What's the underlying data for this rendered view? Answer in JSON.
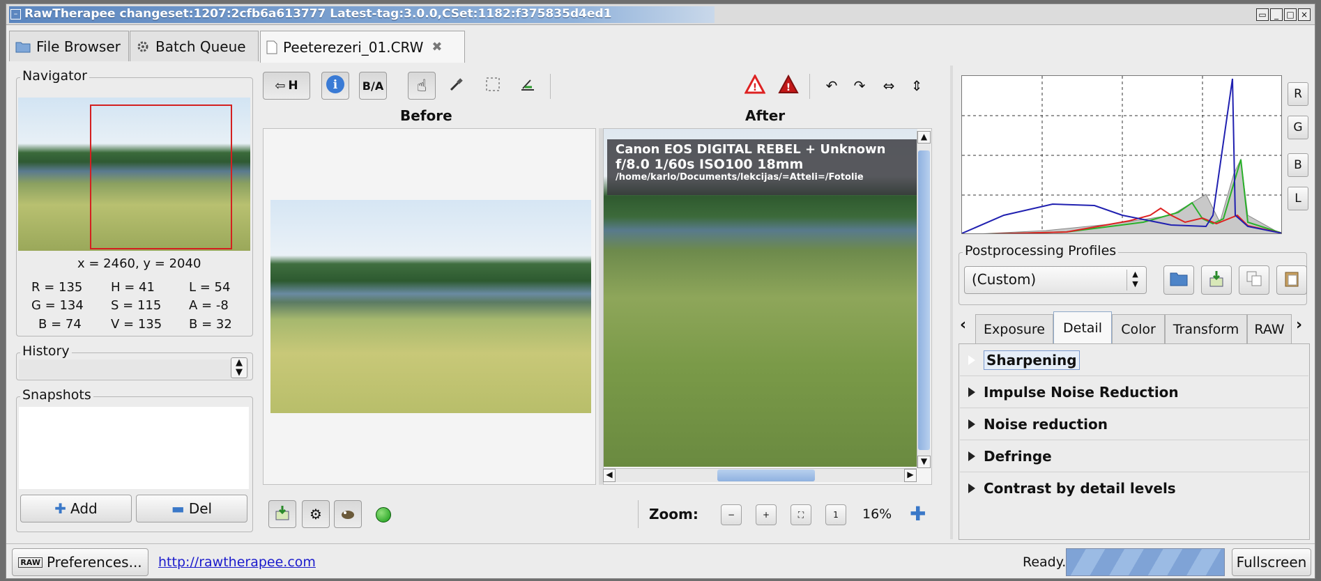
{
  "window": {
    "title": "RawTherapee changeset:1207:2cfb6a613777 Latest-tag:3.0.0,CSet:1182:f375835d4ed1"
  },
  "tabs": [
    {
      "label": "File Browser",
      "icon": "folder-icon"
    },
    {
      "label": "Batch Queue",
      "icon": "gear-icon"
    },
    {
      "label": "Peeterezeri_01.CRW",
      "icon": "document-icon"
    }
  ],
  "navigator": {
    "label": "Navigator",
    "coords": "x = 2460, y = 2040",
    "values": {
      "R": "R = 135",
      "G": "G = 134",
      "B": "B = 74",
      "H": "H = 41",
      "S": "S = 115",
      "V": "V = 135",
      "L": "L = 54",
      "A": "A = -8",
      "B2": "B = 32"
    }
  },
  "history": {
    "label": "History"
  },
  "snapshots": {
    "label": "Snapshots",
    "add": "Add",
    "del": "Del"
  },
  "toolbar": {
    "history_toggle": "H",
    "compare_icon": "B/A"
  },
  "preview": {
    "before": "Before",
    "after": "After"
  },
  "exif": {
    "camera": "Canon EOS DIGITAL REBEL + Unknown",
    "aperture": "f/8.0",
    "shutter": "1/60s",
    "iso": "ISO100",
    "focal": "18mm",
    "path": "/home/karlo/Documents/lekcijas/=Atteli=/Fotolie"
  },
  "zoom": {
    "label": "Zoom:",
    "value": "16%"
  },
  "profiles": {
    "label": "Postprocessing Profiles",
    "selected": "(Custom)"
  },
  "histogram_channels": [
    "R",
    "G",
    "B",
    "L"
  ],
  "tool_tabs": [
    "Exposure",
    "Detail",
    "Color",
    "Transform",
    "RAW"
  ],
  "active_tool_tab": "Detail",
  "tools": [
    "Sharpening",
    "Impulse Noise Reduction",
    "Noise reduction",
    "Defringe",
    "Contrast by detail levels"
  ],
  "statusbar": {
    "preferences": "Preferences...",
    "link": "http://rawtherapee.com",
    "status": "Ready.",
    "fullscreen": "Fullscreen"
  },
  "colors": {
    "accent": "#5b86bf",
    "selection": "#7fa3d6",
    "link": "#1a1acc"
  }
}
